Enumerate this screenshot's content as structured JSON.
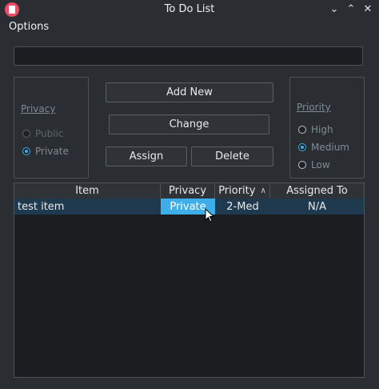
{
  "window": {
    "title": "To Do List",
    "minimize_glyph": "⌄",
    "maximize_glyph": "⌃",
    "close_glyph": "✕"
  },
  "menu": {
    "options_label": "Options"
  },
  "item_input": {
    "value": "",
    "placeholder": ""
  },
  "privacy_group": {
    "title": "Privacy",
    "options": [
      {
        "label": "Public",
        "checked": false,
        "enabled": false
      },
      {
        "label": "Private",
        "checked": true,
        "enabled": true
      }
    ]
  },
  "buttons": {
    "add_new": "Add New",
    "change": "Change",
    "assign": "Assign",
    "delete": "Delete"
  },
  "priority_group": {
    "title": "Priority",
    "options": [
      {
        "label": "High",
        "checked": false
      },
      {
        "label": "Medium",
        "checked": true
      },
      {
        "label": "Low",
        "checked": false
      }
    ]
  },
  "table": {
    "columns": [
      "Item",
      "Privacy",
      "Priority",
      "Assigned To"
    ],
    "sorted_column": "Priority",
    "rows": [
      {
        "item": "test item",
        "privacy": "Private",
        "priority": "2-Med",
        "assigned_to": "N/A"
      }
    ]
  },
  "colors": {
    "accent": "#3daee9",
    "background": "#2a2e32",
    "app_icon": "#ed4a63"
  }
}
